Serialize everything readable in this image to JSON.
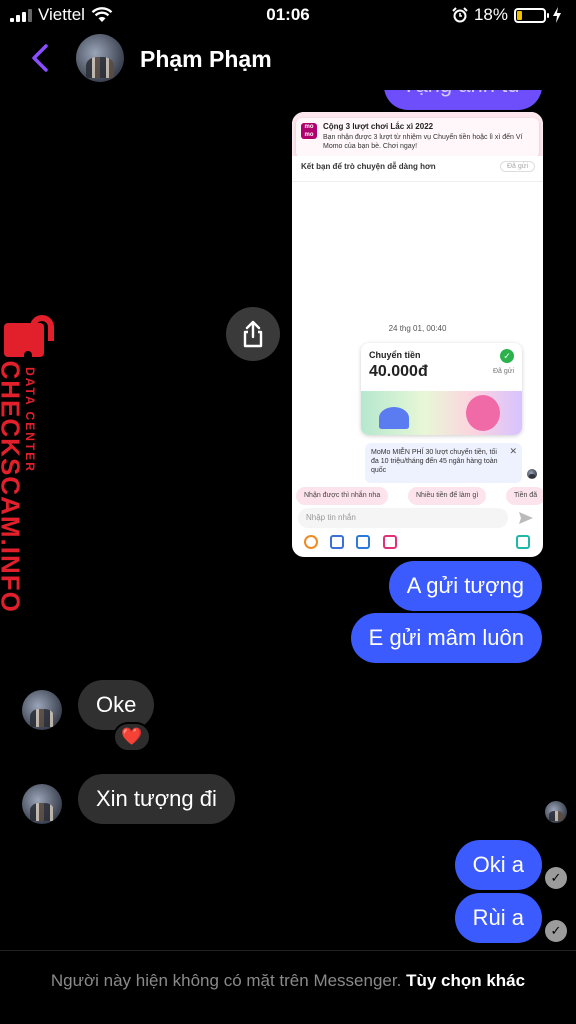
{
  "status_bar": {
    "carrier": "Viettel",
    "time": "01:06",
    "battery": "18%",
    "battery_level": 0.18,
    "battery_color": "#f2c200"
  },
  "header": {
    "contact_name": "Phạm Phạm",
    "accent": "#8a4dff"
  },
  "watermark": {
    "brand": "CHECKSCAM.INFO",
    "sub": "DATA CENTER",
    "color": "#e2202c"
  },
  "messages": {
    "partial_top": "Tặng anh từ",
    "sent_1": "A gửi tượng",
    "sent_2": "E gửi mâm luôn",
    "received_1": "Oke",
    "reaction_1": "❤️",
    "received_2": "Xin tượng đi",
    "sent_3": "Oki a",
    "sent_4": "Rùi a",
    "bubble_out_color": "#3b5bff",
    "bubble_in_color": "#303030"
  },
  "screenshot": {
    "notif_title": "Cộng 3 lượt chơi Lắc xì 2022",
    "notif_desc": "Bạn nhận được 3 lượt từ nhiệm vụ Chuyển tiền hoặc lì xì đến Ví Momo của bạn bè. Chơi ngay!",
    "friend_prompt": "Kết bạn để trò chuyện dễ dàng hơn",
    "friend_status": "Đã gửi",
    "date": "24 thg 01, 00:40",
    "transfer_label": "Chuyển tiền",
    "transfer_amount": "40.000đ",
    "transfer_status": "Đã gửi",
    "promo": "MoMo MIỄN PHÍ 30 lượt chuyển tiền, tối đa 10 triệu/tháng đến 45 ngân hàng toàn quốc",
    "promo_close": "✕",
    "chips": [
      "Nhận được thì nhắn nha",
      "Nhiều tiền để làm gì",
      "Tiền đã"
    ],
    "input_placeholder": "Nhập tin nhắn",
    "logo_text": "mo mo"
  },
  "footer": {
    "text": "Người này hiện không có mặt trên Messenger.",
    "link": "Tùy chọn khác"
  }
}
